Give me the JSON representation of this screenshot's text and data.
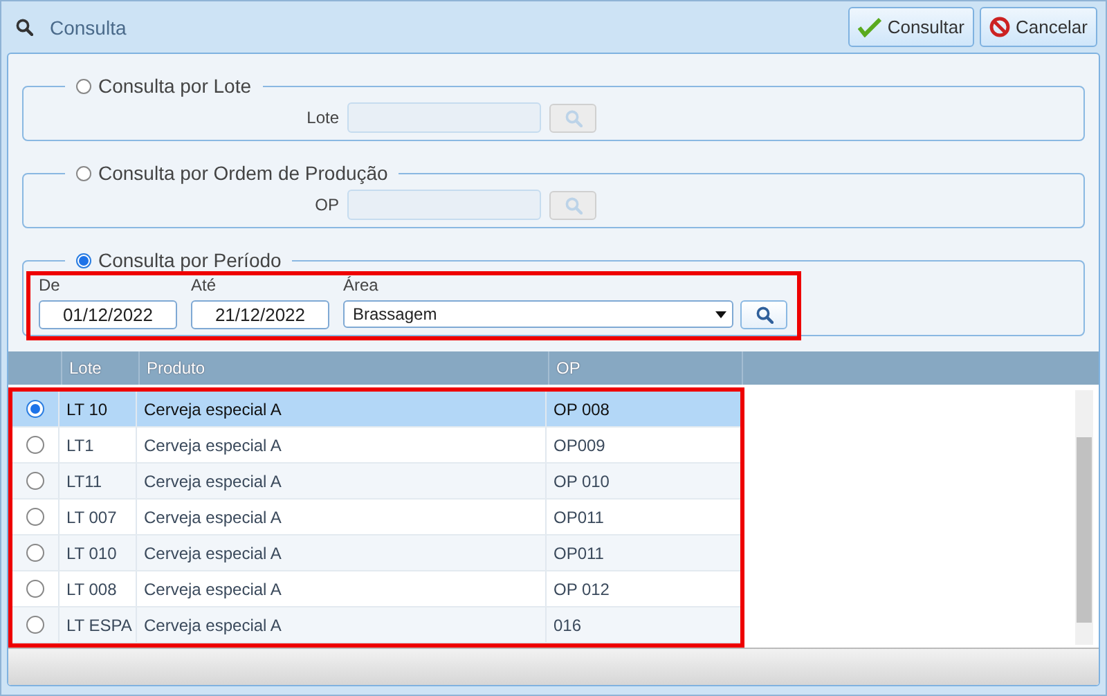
{
  "window": {
    "title": "Consulta"
  },
  "buttons": [
    {
      "kind": "confirm",
      "label": "Consultar"
    },
    {
      "kind": "cancel",
      "label": "Cancelar"
    }
  ],
  "sections": [
    {
      "kind": "single",
      "title": "Consulta por Lote",
      "selected": false,
      "field_label": "Lote"
    },
    {
      "kind": "single",
      "title": "Consulta por Ordem de Produção",
      "selected": false,
      "field_label": "OP"
    },
    {
      "kind": "period",
      "title": "Consulta por Período",
      "selected": true,
      "highlighted": true,
      "from_label": "De",
      "from_value": "01/12/2022",
      "to_label": "Até",
      "to_value": "21/12/2022",
      "area_label": "Área",
      "area_value": "Brassagem"
    }
  ],
  "table": {
    "highlighted": true,
    "columns": [
      "Lote",
      "Produto",
      "OP"
    ],
    "rows": [
      {
        "lote": "LT 10",
        "produto": "Cerveja especial A",
        "op": "OP 008",
        "selected": true
      },
      {
        "lote": "LT1",
        "produto": "Cerveja especial A",
        "op": "OP009",
        "selected": false
      },
      {
        "lote": "LT11",
        "produto": "Cerveja especial A",
        "op": "OP 010",
        "selected": false
      },
      {
        "lote": "LT 007",
        "produto": "Cerveja especial A",
        "op": "OP011",
        "selected": false
      },
      {
        "lote": "LT 010",
        "produto": "Cerveja especial A",
        "op": "OP011",
        "selected": false
      },
      {
        "lote": "LT 008",
        "produto": "Cerveja especial A",
        "op": "OP 012",
        "selected": false
      },
      {
        "lote": "LT ESPA",
        "produto": "Cerveja especial A",
        "op": "016",
        "selected": false
      }
    ]
  }
}
